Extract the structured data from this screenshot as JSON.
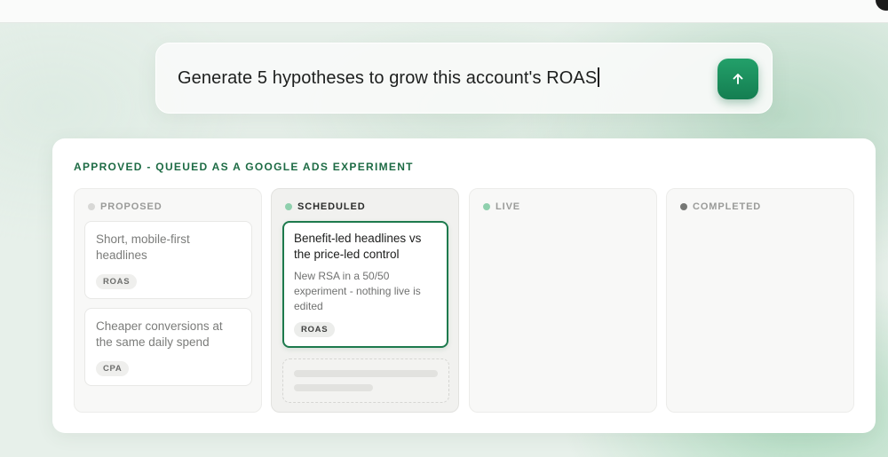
{
  "prompt": {
    "text": "Generate 5 hypotheses to grow this account's ROAS",
    "send_icon": "arrow-up-icon"
  },
  "board": {
    "title": "APPROVED - QUEUED AS A GOOGLE ADS EXPERIMENT",
    "columns": [
      {
        "label": "PROPOSED",
        "dot_color": "#d8d8d6",
        "items": [
          {
            "title": "Short, mobile-first headlines",
            "tag": "ROAS"
          },
          {
            "title": "Cheaper conversions at the same daily spend",
            "tag": "CPA"
          }
        ]
      },
      {
        "label": "SCHEDULED",
        "dot_color": "#8fd0ad",
        "items": [
          {
            "title": "Benefit-led headlines vs the price-led control",
            "description": "New RSA in a 50/50 experiment - nothing live is edited",
            "tag": "ROAS"
          }
        ]
      },
      {
        "label": "LIVE",
        "dot_color": "#8fd0ad",
        "items": []
      },
      {
        "label": "COMPLETED",
        "dot_color": "#767775",
        "items": []
      }
    ]
  },
  "colors": {
    "accent": "#1d7a4d",
    "title_green": "#1d6b44",
    "send_button": "#1a8d5c"
  }
}
